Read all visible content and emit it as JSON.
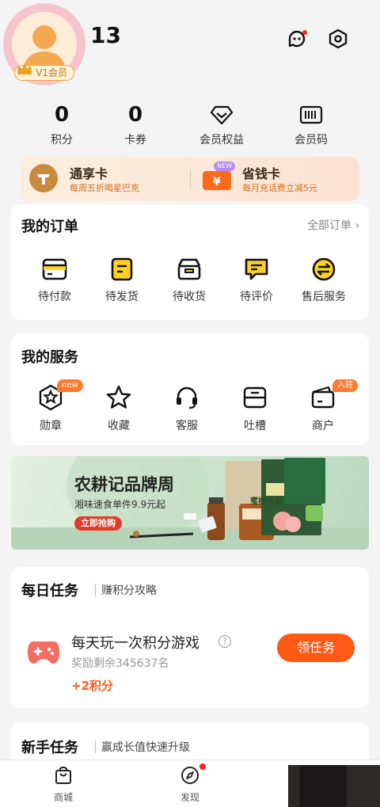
{
  "header": {
    "username": "13",
    "vip_badge": "V1会员",
    "icons": [
      "chat-bot-icon",
      "settings-hex-icon"
    ]
  },
  "stats": [
    {
      "value": "0",
      "label": "积分"
    },
    {
      "value": "0",
      "label": "卡券"
    },
    {
      "icon": "diamond-icon",
      "label": "会员权益"
    },
    {
      "icon": "barcode-icon",
      "label": "会员码"
    }
  ],
  "promo": {
    "left": {
      "title": "通享卡",
      "sub": "每周五折喝星巴克"
    },
    "right": {
      "title": "省钱卡",
      "badge": "NEW",
      "sub": "每月充话费立减5元"
    }
  },
  "orders": {
    "title": "我的订单",
    "all_link": "全部订单",
    "items": [
      "待付款",
      "待发货",
      "待收货",
      "待评价",
      "售后服务"
    ]
  },
  "services": {
    "title": "我的服务",
    "items": [
      {
        "label": "勋章",
        "tag": "new"
      },
      {
        "label": "收藏"
      },
      {
        "label": "客服"
      },
      {
        "label": "吐槽"
      },
      {
        "label": "商户",
        "tag": "入驻"
      }
    ]
  },
  "banner": {
    "title": "农耕记品牌周",
    "sub": "湘味速食单件9.9元起",
    "button": "立即抢购",
    "product_text": "蜜桃乌龙"
  },
  "daily_task": {
    "title": "每日任务",
    "sub": "赚积分攻略",
    "task_name": "每天玩一次积分游戏",
    "help": "?",
    "remain": "奖励剩余345637名",
    "reward": "+2积分",
    "button": "领任务"
  },
  "newbie_task": {
    "title": "新手任务",
    "sub": "赢成长值快速升级"
  },
  "tabbar": {
    "items": [
      {
        "label": "商城",
        "icon": "shopping-bag-icon"
      },
      {
        "label": "发现",
        "icon": "compass-icon"
      }
    ]
  },
  "colors": {
    "accent": "#ff5a14",
    "card": "#ffffff",
    "background": "#f4f4f4"
  }
}
